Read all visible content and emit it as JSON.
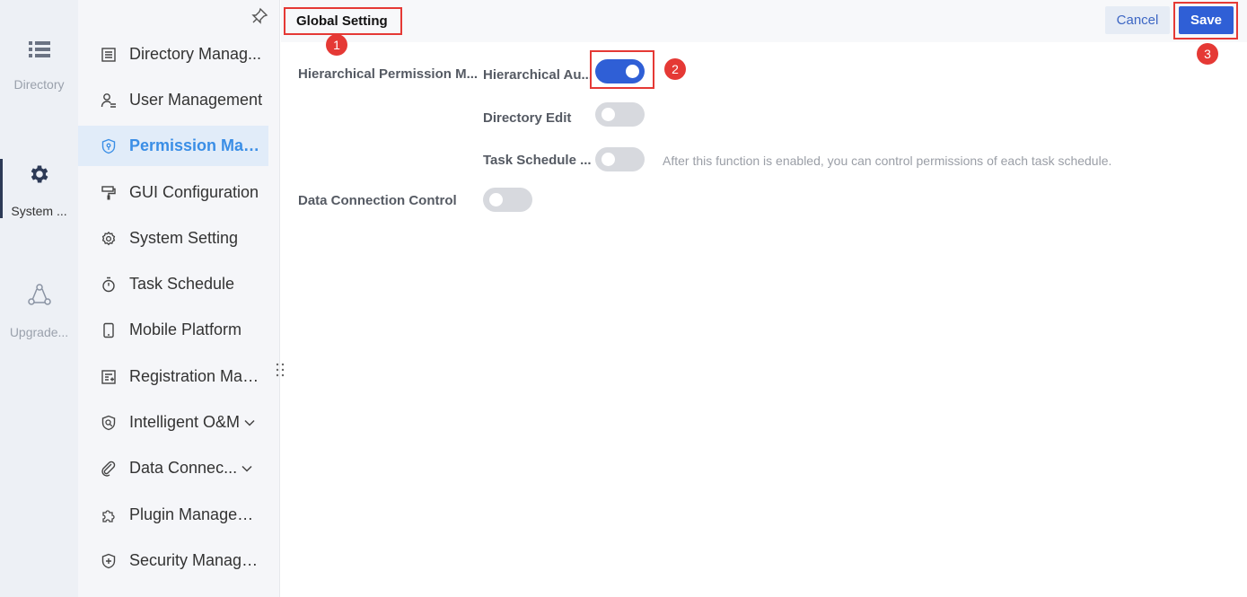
{
  "rail": {
    "items": [
      {
        "label": "Directory",
        "icon": "list-icon"
      },
      {
        "label": "System ...",
        "icon": "gear-icon"
      },
      {
        "label": "Upgrade...",
        "icon": "share-nodes-icon"
      }
    ]
  },
  "nav": {
    "items": [
      {
        "label": "Directory Manag..."
      },
      {
        "label": "User Management"
      },
      {
        "label": "Permission Man..."
      },
      {
        "label": "GUI Configuration"
      },
      {
        "label": "System Setting"
      },
      {
        "label": "Task Schedule"
      },
      {
        "label": "Mobile Platform"
      },
      {
        "label": "Registration Man..."
      },
      {
        "label": "Intelligent O&M"
      },
      {
        "label": "Data Connec..."
      },
      {
        "label": "Plugin Managem..."
      },
      {
        "label": "Security Manage..."
      }
    ]
  },
  "header": {
    "title": "Global Setting",
    "cancel_label": "Cancel",
    "save_label": "Save"
  },
  "badges": [
    "1",
    "2",
    "3"
  ],
  "settings": {
    "hierarchical_permission_label": "Hierarchical Permission M...",
    "hierarchical_auth_label": "Hierarchical Au...",
    "directory_edit_label": "Directory Edit",
    "task_schedule_label": "Task Schedule ...",
    "task_schedule_hint": "After this function is enabled, you can control permissions of each task schedule.",
    "data_connection_label": "Data Connection Control"
  },
  "colors": {
    "accent": "#2f5fd6",
    "annotation": "#e53935",
    "active_nav": "#3a8ee6"
  }
}
